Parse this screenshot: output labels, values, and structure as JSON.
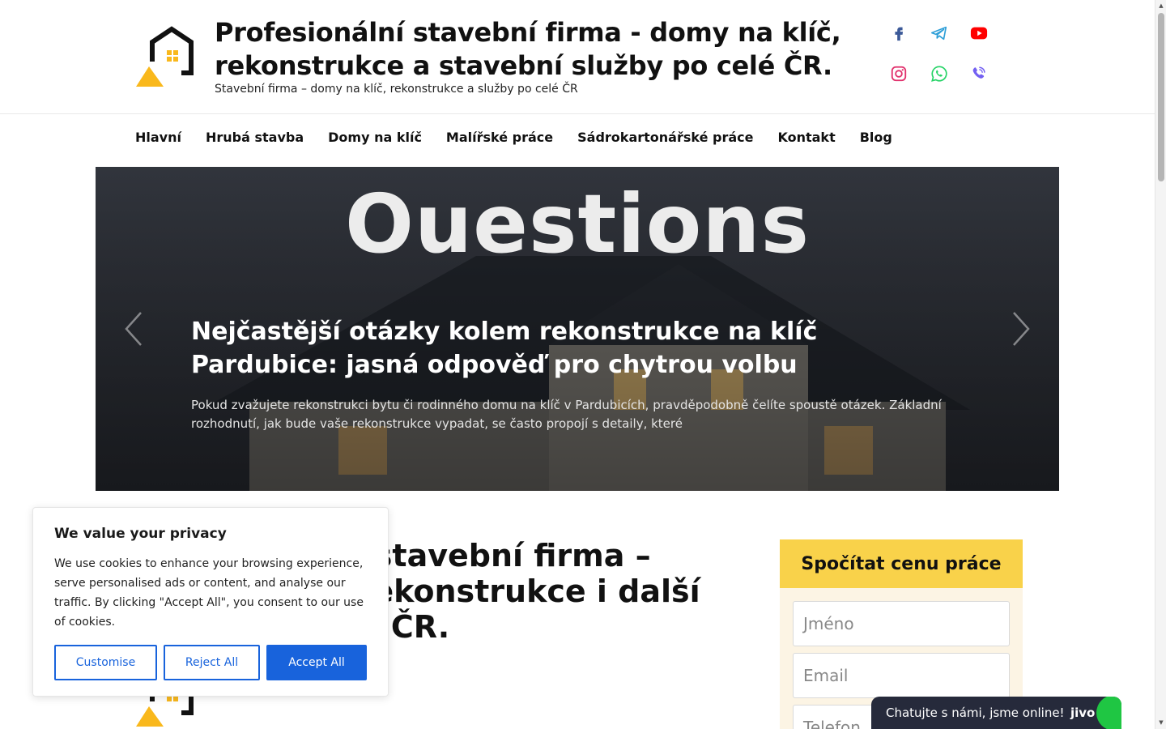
{
  "header": {
    "title": "Profesionální stavební firma - domy na klíč, rekonstrukce a stavební služby po celé ČR.",
    "tagline": "Stavební firma – domy na klíč, rekonstrukce a služby po celé ČR"
  },
  "social": {
    "facebook": "facebook-icon",
    "telegram": "telegram-icon",
    "youtube": "youtube-icon",
    "instagram": "instagram-icon",
    "whatsapp": "whatsapp-icon",
    "viber": "viber-icon"
  },
  "nav": {
    "items": [
      "Hlavní",
      "Hrubá stavba",
      "Domy na klíč",
      "Malířské práce",
      "Sádrokartonářské práce",
      "Kontakt",
      "Blog"
    ]
  },
  "hero": {
    "watermark": "Ouestions",
    "title": "Nejčastější otázky kolem rekonstrukce na klíč Pardubice: jasná odpověď pro chytrou volbu",
    "text": "Pokud zvažujete rekonstrukci bytu či rodinného domu na klíč v Pardubicích, pravděpodobně čelíte spoustě otázek. Základní rozhodnutí, jak bude vaše rekonstrukce vypadat, se často propojí s detaily, které"
  },
  "section": {
    "heading": "Profesionální stavební firma – byty na klíč, rekonstrukce i další služby po celé ČR."
  },
  "calc": {
    "title": "Spočítat cenu práce",
    "name_placeholder": "Jméno",
    "email_placeholder": "Email",
    "phone_placeholder": "Telefon"
  },
  "cookie": {
    "title": "We value your privacy",
    "text": "We use cookies to enhance your browsing experience, serve personalised ads or content, and analyse our traffic. By clicking \"Accept All\", you consent to our use of cookies.",
    "customise": "Customise",
    "reject": "Reject All",
    "accept": "Accept All"
  },
  "chat": {
    "label": "Chatujte s námi, jsme online!",
    "brand": "jivo"
  },
  "colors": {
    "accent_yellow": "#f9d24a",
    "cookie_blue": "#1863dc",
    "chat_dark": "#262a3b",
    "chat_green": "#1fc643"
  }
}
